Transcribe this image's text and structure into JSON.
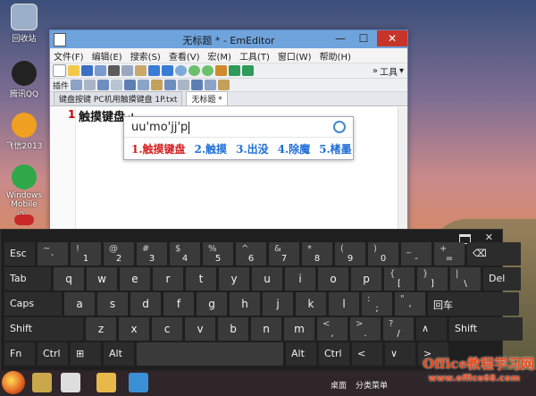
{
  "desktop": {
    "icons": [
      {
        "label": "回收站",
        "color": "#9bb0c8"
      },
      {
        "label": "腾讯QQ",
        "color": "#222222"
      },
      {
        "label": "飞信2013",
        "color": "#f0a020"
      },
      {
        "label": "Windows Mobile 设...",
        "color": "#2fa84a"
      },
      {
        "label": "",
        "color": "#c82828"
      }
    ]
  },
  "window": {
    "title": "无标题 * - EmEditor",
    "minimize": "—",
    "maximize": "☐",
    "close": "✕",
    "menu": [
      "文件(F)",
      "编辑(E)",
      "搜索(S)",
      "查看(V)",
      "宏(M)",
      "工具(T)",
      "窗口(W)",
      "帮助(H)"
    ],
    "toolbar_right": [
      "»",
      "工具",
      "▾"
    ],
    "toolbar2_label": "插件",
    "tabs": [
      "键盘按键 PC机用触摸键盘 1P.txt",
      "无标题 *"
    ],
    "active_tab_index": 1,
    "line_number": "1",
    "line_text": "触摸键盘↵"
  },
  "ime": {
    "input": "uu'mo'jj'p",
    "candidates": [
      "1.触摸键盘",
      "2.触摸",
      "3.出没",
      "4.除魔",
      "5.楮墨"
    ],
    "nav": "‹ ›"
  },
  "keyboard": {
    "top_icons": [
      "dock-icon",
      "close-icon"
    ],
    "close_glyph": "✕",
    "row1": [
      {
        "label": "Esc",
        "type": "fn"
      },
      {
        "top": "~",
        "bottom": "`"
      },
      {
        "top": "!",
        "bottom": "1"
      },
      {
        "top": "@",
        "bottom": "2"
      },
      {
        "top": "#",
        "bottom": "3"
      },
      {
        "top": "$",
        "bottom": "4"
      },
      {
        "top": "%",
        "bottom": "5"
      },
      {
        "top": "^",
        "bottom": "6"
      },
      {
        "top": "&",
        "bottom": "7"
      },
      {
        "top": "*",
        "bottom": "8"
      },
      {
        "top": "(",
        "bottom": "9"
      },
      {
        "top": ")",
        "bottom": "0"
      },
      {
        "top": "_",
        "bottom": "-"
      },
      {
        "top": "+",
        "bottom": "="
      },
      {
        "label": "⌫",
        "type": "fn"
      }
    ],
    "row2": [
      {
        "label": "Tab",
        "type": "fn"
      },
      {
        "main": "q"
      },
      {
        "main": "w"
      },
      {
        "main": "e"
      },
      {
        "main": "r"
      },
      {
        "main": "t"
      },
      {
        "main": "y"
      },
      {
        "main": "u"
      },
      {
        "main": "i"
      },
      {
        "main": "o"
      },
      {
        "main": "p"
      },
      {
        "top": "{",
        "bottom": "["
      },
      {
        "top": "}",
        "bottom": "]"
      },
      {
        "top": "|",
        "bottom": "\\"
      },
      {
        "label": "Del",
        "type": "fn"
      }
    ],
    "row3": [
      {
        "label": "Caps",
        "type": "fn"
      },
      {
        "main": "a"
      },
      {
        "main": "s"
      },
      {
        "main": "d"
      },
      {
        "main": "f"
      },
      {
        "main": "g"
      },
      {
        "main": "h"
      },
      {
        "main": "j"
      },
      {
        "main": "k"
      },
      {
        "main": "l"
      },
      {
        "top": ":",
        "bottom": ";"
      },
      {
        "top": "\"",
        "bottom": "'"
      },
      {
        "label": "回车",
        "type": "fn"
      }
    ],
    "row4": [
      {
        "label": "Shift",
        "type": "fn"
      },
      {
        "main": "z"
      },
      {
        "main": "x"
      },
      {
        "main": "c"
      },
      {
        "main": "v"
      },
      {
        "main": "b"
      },
      {
        "main": "n"
      },
      {
        "main": "m"
      },
      {
        "top": "<",
        "bottom": ","
      },
      {
        "top": ">",
        "bottom": "."
      },
      {
        "top": "?",
        "bottom": "/"
      },
      {
        "label": "∧",
        "type": "fn"
      },
      {
        "label": "Shift",
        "type": "fn"
      }
    ],
    "row5": [
      {
        "label": "Fn",
        "type": "fn"
      },
      {
        "label": "Ctrl",
        "type": "fn"
      },
      {
        "label": "⊞",
        "type": "fn"
      },
      {
        "label": "Alt",
        "type": "fn"
      },
      {
        "label": "",
        "type": "space"
      },
      {
        "label": "Alt",
        "type": "fn"
      },
      {
        "label": "Ctrl",
        "type": "fn"
      },
      {
        "label": "<",
        "type": "fn"
      },
      {
        "label": "∨",
        "type": "fn"
      },
      {
        "label": ">",
        "type": "fn"
      }
    ]
  },
  "taskbar": {
    "tray": [
      "桌面",
      "分类菜单"
    ],
    "watermark": "Office教程学习网",
    "watermark_url": "www.office68.com"
  }
}
